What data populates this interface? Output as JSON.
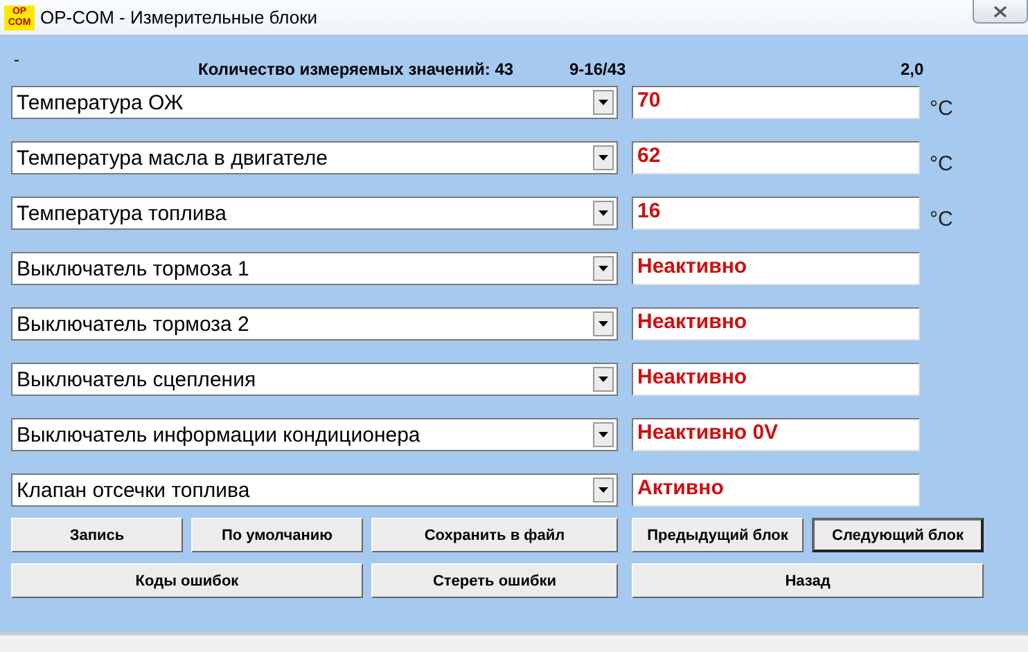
{
  "window": {
    "title": "OP-COM - Измерительные блоки",
    "logo": "OP COM"
  },
  "header": {
    "marker": "-",
    "count_label": "Количество измеряемых значений: 43",
    "range": "9-16/43",
    "value": "2,0"
  },
  "rows": [
    {
      "name": "Температура ОЖ",
      "value": "70",
      "unit": "°C"
    },
    {
      "name": "Температура масла в двигателе",
      "value": "62",
      "unit": "°C"
    },
    {
      "name": "Температура топлива",
      "value": "16",
      "unit": "°C"
    },
    {
      "name": "Выключатель тормоза 1",
      "value": "Неактивно"
    },
    {
      "name": "Выключатель тормоза 2",
      "value": "Неактивно"
    },
    {
      "name": "Выключатель сцепления",
      "value": "Неактивно"
    },
    {
      "name": "Выключатель информации кондиционера",
      "value": "Неактивно 0V"
    },
    {
      "name": "Клапан отсечки топлива",
      "value": "Активно"
    }
  ],
  "buttons_row_1": [
    {
      "label": "Запись",
      "selected": false
    },
    {
      "label": "По умолчанию",
      "selected": false
    },
    {
      "label": "Сохранить в файл",
      "selected": false
    },
    {
      "label": "Предыдущий блок",
      "selected": false
    },
    {
      "label": "Следующий блок",
      "selected": true
    }
  ],
  "buttons_row_2": [
    "Коды ошибок",
    "Стереть ошибки",
    "Назад"
  ]
}
